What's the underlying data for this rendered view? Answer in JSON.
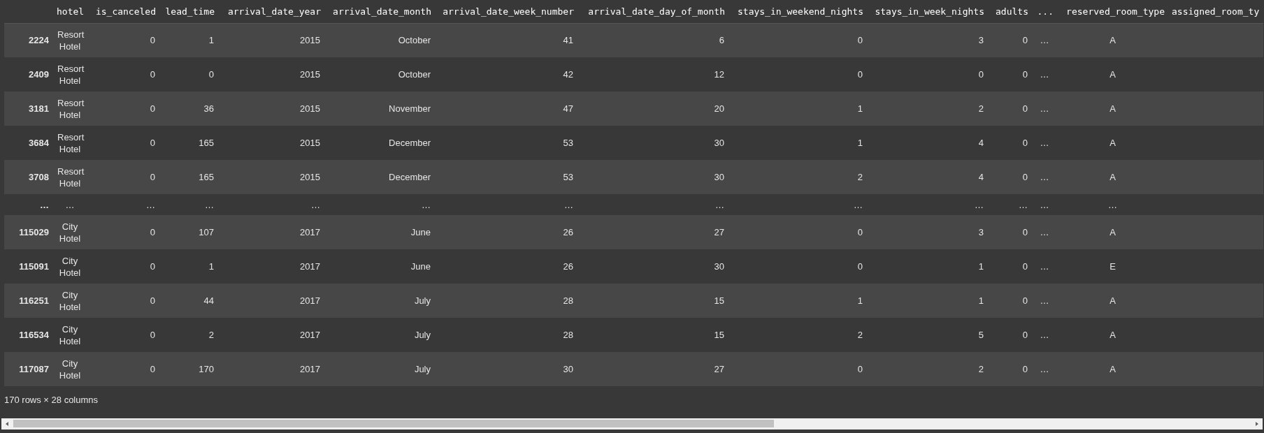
{
  "table": {
    "columns": [
      {
        "kind": "index"
      },
      {
        "label": "hotel",
        "kind": "category"
      },
      {
        "label": "is_canceled",
        "kind": "number"
      },
      {
        "label": "lead_time",
        "kind": "number"
      },
      {
        "label": "arrival_date_year",
        "kind": "number"
      },
      {
        "label": "arrival_date_month",
        "kind": "number"
      },
      {
        "label": "arrival_date_week_number",
        "kind": "number"
      },
      {
        "label": "arrival_date_day_of_month",
        "kind": "number"
      },
      {
        "label": "stays_in_weekend_nights",
        "kind": "number"
      },
      {
        "label": "stays_in_week_nights",
        "kind": "number"
      },
      {
        "label": "adults",
        "kind": "number"
      },
      {
        "label": "...",
        "kind": "ellipsis"
      },
      {
        "label": "reserved_room_type",
        "kind": "category"
      },
      {
        "label": "assigned_room_ty",
        "kind": "cut"
      }
    ],
    "rows": [
      [
        "2224",
        "Resort Hotel",
        "0",
        "1",
        "2015",
        "October",
        "41",
        "6",
        "0",
        "3",
        "0",
        "…",
        "A"
      ],
      [
        "2409",
        "Resort Hotel",
        "0",
        "0",
        "2015",
        "October",
        "42",
        "12",
        "0",
        "0",
        "0",
        "…",
        "A"
      ],
      [
        "3181",
        "Resort Hotel",
        "0",
        "36",
        "2015",
        "November",
        "47",
        "20",
        "1",
        "2",
        "0",
        "…",
        "A"
      ],
      [
        "3684",
        "Resort Hotel",
        "0",
        "165",
        "2015",
        "December",
        "53",
        "30",
        "1",
        "4",
        "0",
        "…",
        "A"
      ],
      [
        "3708",
        "Resort Hotel",
        "0",
        "165",
        "2015",
        "December",
        "53",
        "30",
        "2",
        "4",
        "0",
        "…",
        "A"
      ],
      [
        "…",
        "…",
        "…",
        "…",
        "…",
        "…",
        "…",
        "…",
        "…",
        "…",
        "…",
        "…",
        "…"
      ],
      [
        "115029",
        "City Hotel",
        "0",
        "107",
        "2017",
        "June",
        "26",
        "27",
        "0",
        "3",
        "0",
        "…",
        "A"
      ],
      [
        "115091",
        "City Hotel",
        "0",
        "1",
        "2017",
        "June",
        "26",
        "30",
        "0",
        "1",
        "0",
        "…",
        "E"
      ],
      [
        "116251",
        "City Hotel",
        "0",
        "44",
        "2017",
        "July",
        "28",
        "15",
        "1",
        "1",
        "0",
        "…",
        "A"
      ],
      [
        "116534",
        "City Hotel",
        "0",
        "2",
        "2017",
        "July",
        "28",
        "15",
        "2",
        "5",
        "0",
        "…",
        "A"
      ],
      [
        "117087",
        "City Hotel",
        "0",
        "170",
        "2017",
        "July",
        "30",
        "27",
        "0",
        "2",
        "0",
        "…",
        "A"
      ]
    ]
  },
  "caption": "170 rows × 28 columns"
}
